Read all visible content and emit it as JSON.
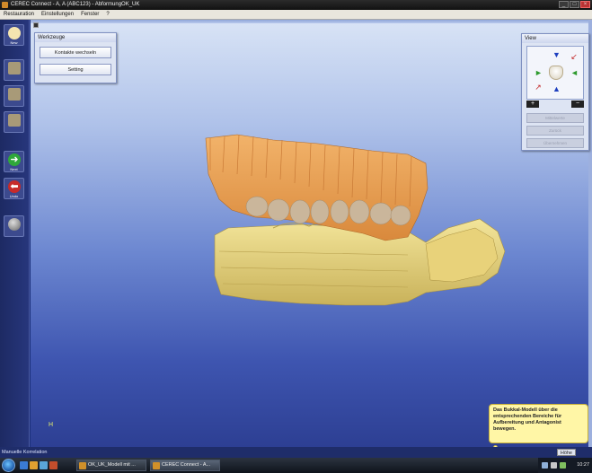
{
  "window": {
    "title": "CEREC Connect - A, A (ABC123) - AbformungOK_UK"
  },
  "menu": {
    "items": [
      "Restauration",
      "Einstellungen",
      "Fenster",
      "?"
    ]
  },
  "toolbar": {
    "new_label": "New",
    "next_label": "Next",
    "undo_label": "Undo"
  },
  "werkzeuge": {
    "title": "Werkzeuge",
    "buttons": [
      "Kontakte wechseln",
      "Setting"
    ]
  },
  "view_panel": {
    "title": "View",
    "zoom_in": "+",
    "zoom_out": "−",
    "buttons": [
      "Mittelwerte",
      "Zurück",
      "Übernehmen"
    ]
  },
  "tooltip": {
    "text": "Das Bukkal-Modell über die entsprechenden Bereiche für Aufbereitung und Antagonist bewegen."
  },
  "axis_marker": "H",
  "statusbar": {
    "left": "Manuelle Korrelation",
    "right": "Höhe"
  },
  "taskbar": {
    "tasks": [
      "OK_UK_Modell mit ...",
      "CEREC Connect - A..."
    ],
    "clock": "10:27"
  }
}
